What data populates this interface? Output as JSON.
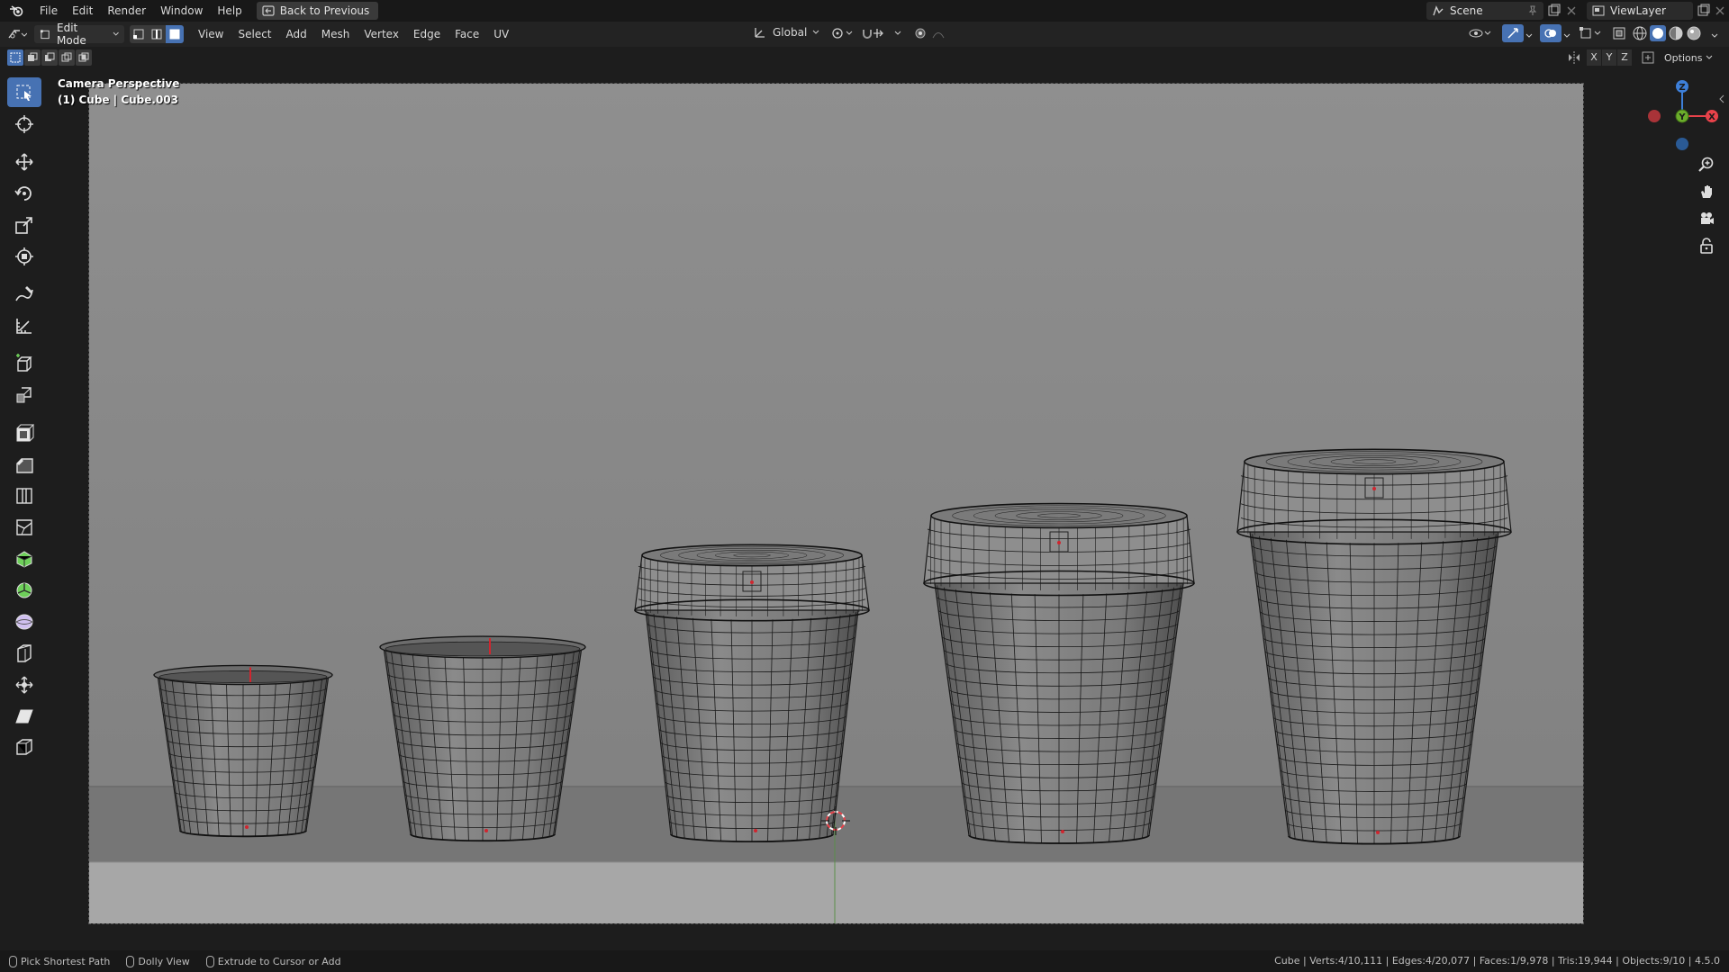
{
  "menu": {
    "file": "File",
    "edit": "Edit",
    "render": "Render",
    "window": "Window",
    "help": "Help",
    "back_to_previous": "Back to Previous"
  },
  "scene": {
    "scene_name": "Scene",
    "view_layer": "ViewLayer"
  },
  "header": {
    "mode": "Edit Mode",
    "menus": [
      "View",
      "Select",
      "Add",
      "Mesh",
      "Vertex",
      "Edge",
      "Face",
      "UV"
    ],
    "orientation": "Global",
    "options": "Options",
    "axes": [
      "X",
      "Y",
      "Z"
    ]
  },
  "viewport": {
    "perspective_label": "Camera Perspective",
    "object_label": "(1) Cube | Cube.003",
    "gizmo": {
      "x": "X",
      "y": "Y",
      "z": "Z"
    }
  },
  "toolbar": {
    "tools": [
      "select-box-icon",
      "cursor-icon",
      "move-icon",
      "rotate-icon",
      "scale-icon",
      "transform-icon",
      "annotate-icon",
      "measure-icon",
      "add-cube-icon",
      "extrude-region-icon",
      "inset-faces-icon",
      "bevel-icon",
      "loop-cut-icon",
      "knife-icon",
      "poly-build-icon",
      "spin-icon",
      "smooth-icon",
      "edge-slide-icon",
      "shrink-fatten-icon",
      "shear-icon",
      "rip-region-icon"
    ]
  },
  "status": {
    "hint_left": "Pick Shortest Path",
    "hint_middle": "Dolly View",
    "hint_right": "Extrude to Cursor or Add",
    "stats": "Cube | Verts:4/10,111 | Edges:4/20,077 | Faces:1/9,978 | Tris:19,944 | Objects:9/10 | 4.5.0"
  },
  "colors": {
    "accent": "#4772b3",
    "axis_x": "#e8424a",
    "axis_y": "#6bad2b",
    "axis_z": "#3d7fd9",
    "viewport_bg": "#8a8a8a"
  }
}
